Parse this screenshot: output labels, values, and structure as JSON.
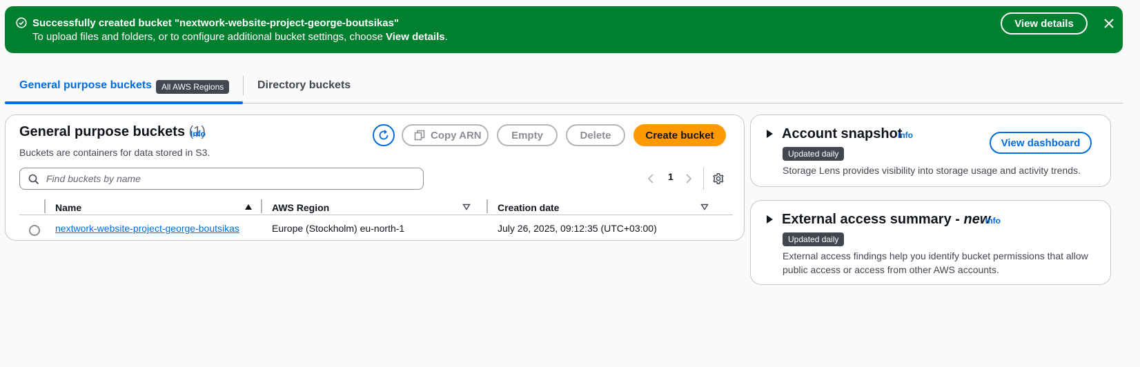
{
  "flash": {
    "title": "Successfully created bucket \"nextwork-website-project-george-boutsikas\"",
    "message_prefix": "To upload files and folders, or to configure additional bucket settings, choose ",
    "message_bold": "View details",
    "message_suffix": ".",
    "view_details_label": "View details",
    "icon": "success-check-icon",
    "color": "#00802f"
  },
  "tabs": {
    "general_label": "General purpose buckets",
    "general_badge": "All AWS Regions",
    "directory_label": "Directory buckets"
  },
  "main": {
    "title": "General purpose buckets",
    "count": "(1)",
    "info": "Info",
    "description": "Buckets are containers for data stored in S3.",
    "buttons": {
      "copy_arn": "Copy ARN",
      "empty": "Empty",
      "delete": "Delete",
      "create": "Create bucket"
    },
    "search_placeholder": "Find buckets by name",
    "page": "1",
    "columns": [
      "Name",
      "AWS Region",
      "Creation date"
    ],
    "rows": [
      {
        "name": "nextwork-website-project-george-boutsikas",
        "region": "Europe (Stockholm) eu-north-1",
        "created": "July 26, 2025, 09:12:35 (UTC+03:00)"
      }
    ]
  },
  "snapshot": {
    "title": "Account snapshot",
    "info": "Info",
    "badge": "Updated daily",
    "description": "Storage Lens provides visibility into storage usage and activity trends.",
    "button": "View dashboard"
  },
  "external": {
    "title": "External access summary - ",
    "title_new": "new",
    "info": "Info",
    "badge": "Updated daily",
    "description_line1": "External access findings help you identify bucket permissions that allow",
    "description_line2": "public access or access from other AWS accounts."
  },
  "colors": {
    "accent": "#006ce0",
    "primary": "#ff9900",
    "success": "#00802f"
  }
}
